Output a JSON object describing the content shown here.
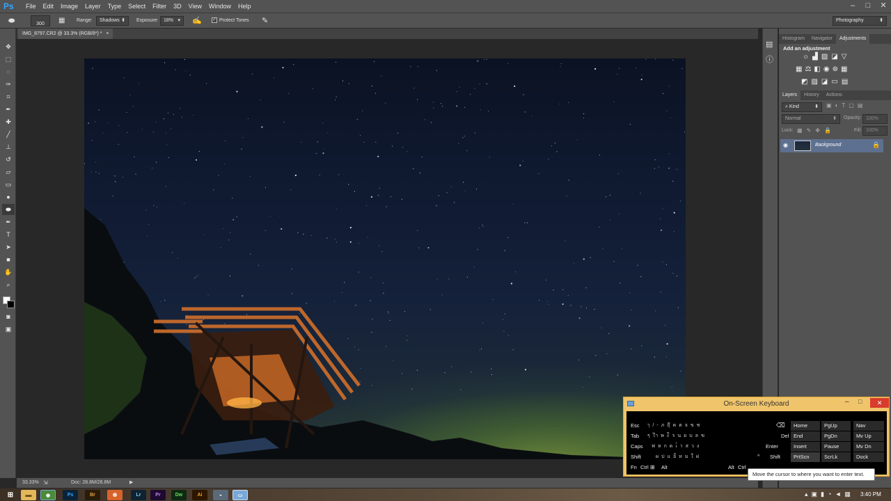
{
  "app": {
    "logo": "Ps",
    "workspace": "Photography"
  },
  "menu": [
    "File",
    "Edit",
    "Image",
    "Layer",
    "Type",
    "Select",
    "Filter",
    "3D",
    "View",
    "Window",
    "Help"
  ],
  "options": {
    "brush_size": "300",
    "range_label": "Range:",
    "range_value": "Shadows",
    "exposure_label": "Exposure:",
    "exposure_value": "18%",
    "protect_tones": "Protect Tones"
  },
  "document": {
    "tab_title": "IMG_8797.CR2 @ 33.3% (RGB/8*) *",
    "close": "×"
  },
  "status": {
    "zoom": "33.33%",
    "doc_info": "Doc: 28.8M/28.8M"
  },
  "panels": {
    "top_tabs": [
      "Histogram",
      "Navigator",
      "Adjustments"
    ],
    "adjustments_title": "Add an adjustment",
    "layer_tabs": [
      "Layers",
      "History",
      "Actions"
    ],
    "kind_filter": "Kind",
    "blend_mode": "Normal",
    "opacity_label": "Opacity:",
    "opacity_value": "100%",
    "lock_label": "Lock:",
    "fill_label": "Fill:",
    "fill_value": "100%",
    "layer_name": "Background"
  },
  "osk": {
    "title": "On-Screen Keyboard",
    "keys_left": [
      "Esc",
      "Tab",
      "Caps",
      "Shift",
      "Fn",
      "Ctrl",
      "Alt",
      "Alt",
      "Ctrl"
    ],
    "keys_right": [
      "Del",
      "Enter",
      "Shift"
    ],
    "nav_keys": [
      "Home",
      "PgUp",
      "Nav",
      "End",
      "PgDn",
      "Mv Up",
      "Insert",
      "Pause",
      "Mv Dn",
      "PrtScn",
      "ScrLk",
      "Dock"
    ],
    "tooltip": "Move the cursor to where you want to enter text."
  },
  "taskbar": {
    "apps": [
      "Ps",
      "Br",
      "Lr",
      "Pr",
      "Dw",
      "Ai"
    ],
    "clock": "3:40 PM"
  }
}
